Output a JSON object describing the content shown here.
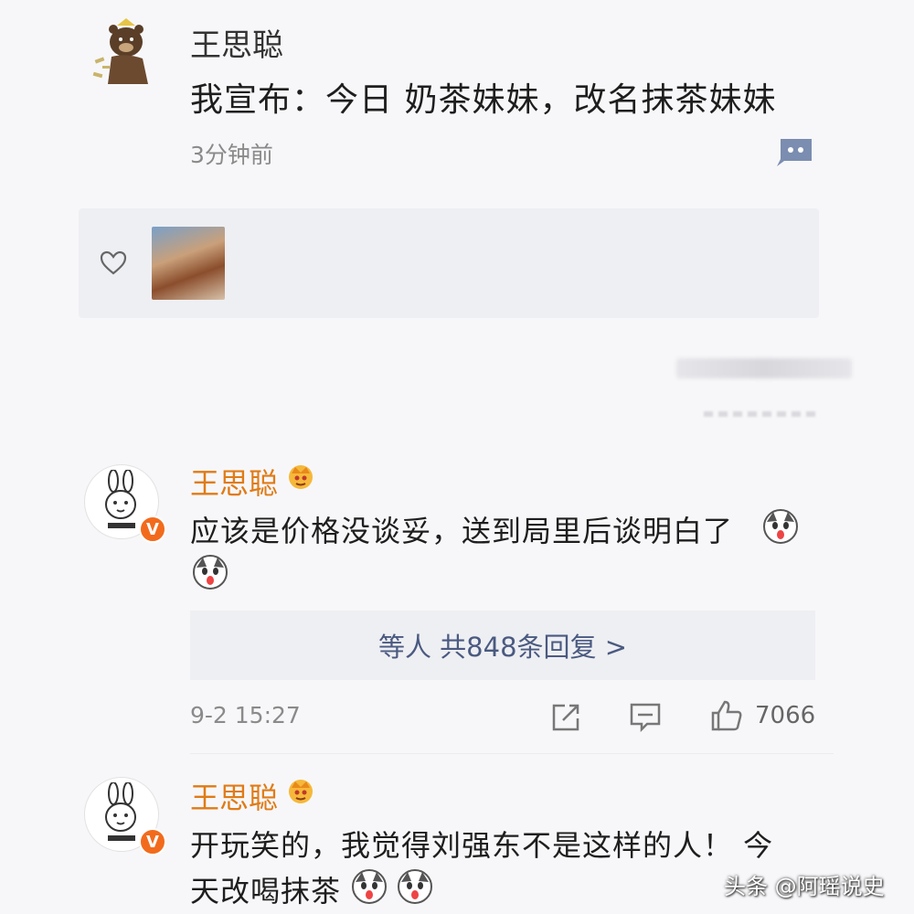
{
  "post": {
    "author": "王思聪",
    "text": "我宣布：今日 奶茶妹妹，改名抹茶妹妹",
    "time": "3分钟前"
  },
  "comments": [
    {
      "author": "王思聪",
      "text": "应该是价格没谈妥，送到局里后谈明白了",
      "reply_summary": "等人  共848条回复 >",
      "time": "9-2 15:27",
      "likes": "7066",
      "verified": "V"
    },
    {
      "author": "王思聪",
      "text_line1": "开玩笑的，我觉得刘强东不是这样的人！ 今",
      "text_line2": "天改喝抹茶",
      "verified": "V"
    }
  ],
  "watermark": "头条 @阿瑶说史",
  "colors": {
    "background": "#f7f7f9",
    "author_gold": "#e07b16",
    "verified_orange": "#f26b1d",
    "reply_link": "#4a5a80",
    "meta_gray": "#8a8a8a"
  },
  "icons": [
    "bear-avatar-icon",
    "comment-bubble-icon",
    "heart-icon",
    "crown-icon",
    "verified-icon",
    "husky-emoji-icon",
    "share-icon",
    "comment-icon",
    "thumbs-up-icon"
  ]
}
